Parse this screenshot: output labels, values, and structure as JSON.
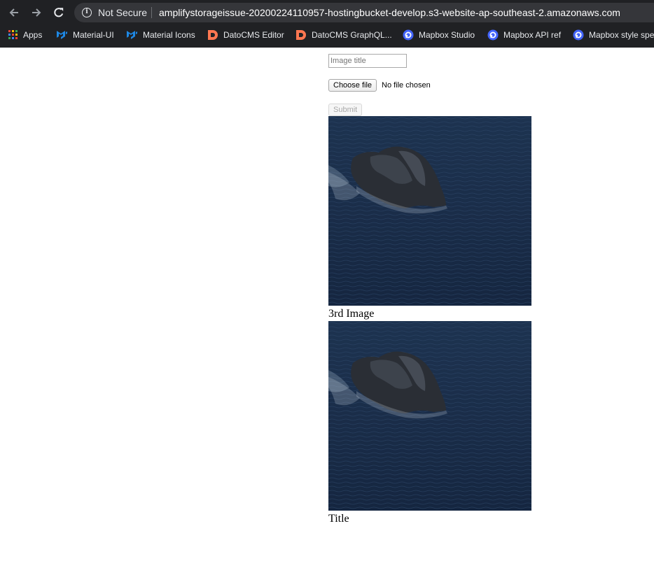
{
  "browser": {
    "security_label": "Not Secure",
    "url": "amplifystorageissue-20200224110957-hostingbucket-develop.s3-website-ap-southeast-2.amazonaws.com",
    "bookmarks": [
      {
        "label": "Apps",
        "icon": "apps-grid-icon"
      },
      {
        "label": "Material-UI",
        "icon": "material-ui-icon"
      },
      {
        "label": "Material Icons",
        "icon": "material-ui-icon"
      },
      {
        "label": "DatoCMS Editor",
        "icon": "datocms-icon"
      },
      {
        "label": "DatoCMS GraphQL...",
        "icon": "datocms-icon"
      },
      {
        "label": "Mapbox Studio",
        "icon": "mapbox-icon"
      },
      {
        "label": "Mapbox API ref",
        "icon": "mapbox-icon"
      },
      {
        "label": "Mapbox style spe",
        "icon": "mapbox-icon"
      }
    ],
    "colors": {
      "chrome": "#202124",
      "omnibox": "#35363a",
      "material_ui": "#1e88e5",
      "datocms": "#ff7751",
      "mapbox": "#4264fb"
    }
  },
  "form": {
    "title_placeholder": "Image title",
    "title_value": "",
    "choose_file_label": "Choose file",
    "file_status": "No file chosen",
    "submit_label": "Submit"
  },
  "images": [
    {
      "caption": "3rd Image"
    },
    {
      "caption": "Title"
    }
  ]
}
